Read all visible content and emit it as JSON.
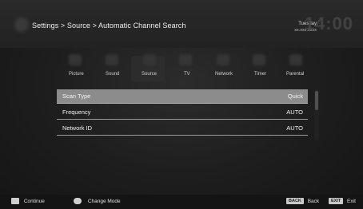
{
  "header": {
    "breadcrumb": "Settings > Source > Automatic Channel Search",
    "day": "Tuesday",
    "date": "xx.xxx.xxxx",
    "clock": "14:00"
  },
  "categories": [
    "Picture",
    "Sound",
    "Source",
    "TV",
    "Network",
    "Timer",
    "Parental"
  ],
  "settings": [
    {
      "label": "Scan Type",
      "value": "Quick"
    },
    {
      "label": "Frequency",
      "value": "AUTO"
    },
    {
      "label": "Network ID",
      "value": "AUTO"
    }
  ],
  "footer": {
    "continue": "Continue",
    "change_mode": "Change Mode",
    "back_key": "BACK",
    "back": "Back",
    "exit_key": "EXIT",
    "exit": "Exit"
  }
}
